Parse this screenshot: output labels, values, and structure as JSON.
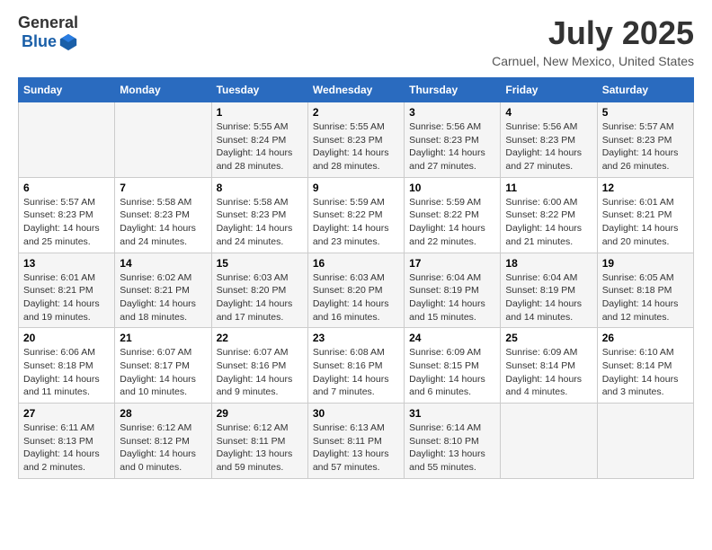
{
  "header": {
    "logo_general": "General",
    "logo_blue": "Blue",
    "title": "July 2025",
    "location": "Carnuel, New Mexico, United States"
  },
  "calendar": {
    "days_of_week": [
      "Sunday",
      "Monday",
      "Tuesday",
      "Wednesday",
      "Thursday",
      "Friday",
      "Saturday"
    ],
    "weeks": [
      [
        {
          "day": "",
          "content": ""
        },
        {
          "day": "",
          "content": ""
        },
        {
          "day": "1",
          "content": "Sunrise: 5:55 AM\nSunset: 8:24 PM\nDaylight: 14 hours and 28 minutes."
        },
        {
          "day": "2",
          "content": "Sunrise: 5:55 AM\nSunset: 8:23 PM\nDaylight: 14 hours and 28 minutes."
        },
        {
          "day": "3",
          "content": "Sunrise: 5:56 AM\nSunset: 8:23 PM\nDaylight: 14 hours and 27 minutes."
        },
        {
          "day": "4",
          "content": "Sunrise: 5:56 AM\nSunset: 8:23 PM\nDaylight: 14 hours and 27 minutes."
        },
        {
          "day": "5",
          "content": "Sunrise: 5:57 AM\nSunset: 8:23 PM\nDaylight: 14 hours and 26 minutes."
        }
      ],
      [
        {
          "day": "6",
          "content": "Sunrise: 5:57 AM\nSunset: 8:23 PM\nDaylight: 14 hours and 25 minutes."
        },
        {
          "day": "7",
          "content": "Sunrise: 5:58 AM\nSunset: 8:23 PM\nDaylight: 14 hours and 24 minutes."
        },
        {
          "day": "8",
          "content": "Sunrise: 5:58 AM\nSunset: 8:23 PM\nDaylight: 14 hours and 24 minutes."
        },
        {
          "day": "9",
          "content": "Sunrise: 5:59 AM\nSunset: 8:22 PM\nDaylight: 14 hours and 23 minutes."
        },
        {
          "day": "10",
          "content": "Sunrise: 5:59 AM\nSunset: 8:22 PM\nDaylight: 14 hours and 22 minutes."
        },
        {
          "day": "11",
          "content": "Sunrise: 6:00 AM\nSunset: 8:22 PM\nDaylight: 14 hours and 21 minutes."
        },
        {
          "day": "12",
          "content": "Sunrise: 6:01 AM\nSunset: 8:21 PM\nDaylight: 14 hours and 20 minutes."
        }
      ],
      [
        {
          "day": "13",
          "content": "Sunrise: 6:01 AM\nSunset: 8:21 PM\nDaylight: 14 hours and 19 minutes."
        },
        {
          "day": "14",
          "content": "Sunrise: 6:02 AM\nSunset: 8:21 PM\nDaylight: 14 hours and 18 minutes."
        },
        {
          "day": "15",
          "content": "Sunrise: 6:03 AM\nSunset: 8:20 PM\nDaylight: 14 hours and 17 minutes."
        },
        {
          "day": "16",
          "content": "Sunrise: 6:03 AM\nSunset: 8:20 PM\nDaylight: 14 hours and 16 minutes."
        },
        {
          "day": "17",
          "content": "Sunrise: 6:04 AM\nSunset: 8:19 PM\nDaylight: 14 hours and 15 minutes."
        },
        {
          "day": "18",
          "content": "Sunrise: 6:04 AM\nSunset: 8:19 PM\nDaylight: 14 hours and 14 minutes."
        },
        {
          "day": "19",
          "content": "Sunrise: 6:05 AM\nSunset: 8:18 PM\nDaylight: 14 hours and 12 minutes."
        }
      ],
      [
        {
          "day": "20",
          "content": "Sunrise: 6:06 AM\nSunset: 8:18 PM\nDaylight: 14 hours and 11 minutes."
        },
        {
          "day": "21",
          "content": "Sunrise: 6:07 AM\nSunset: 8:17 PM\nDaylight: 14 hours and 10 minutes."
        },
        {
          "day": "22",
          "content": "Sunrise: 6:07 AM\nSunset: 8:16 PM\nDaylight: 14 hours and 9 minutes."
        },
        {
          "day": "23",
          "content": "Sunrise: 6:08 AM\nSunset: 8:16 PM\nDaylight: 14 hours and 7 minutes."
        },
        {
          "day": "24",
          "content": "Sunrise: 6:09 AM\nSunset: 8:15 PM\nDaylight: 14 hours and 6 minutes."
        },
        {
          "day": "25",
          "content": "Sunrise: 6:09 AM\nSunset: 8:14 PM\nDaylight: 14 hours and 4 minutes."
        },
        {
          "day": "26",
          "content": "Sunrise: 6:10 AM\nSunset: 8:14 PM\nDaylight: 14 hours and 3 minutes."
        }
      ],
      [
        {
          "day": "27",
          "content": "Sunrise: 6:11 AM\nSunset: 8:13 PM\nDaylight: 14 hours and 2 minutes."
        },
        {
          "day": "28",
          "content": "Sunrise: 6:12 AM\nSunset: 8:12 PM\nDaylight: 14 hours and 0 minutes."
        },
        {
          "day": "29",
          "content": "Sunrise: 6:12 AM\nSunset: 8:11 PM\nDaylight: 13 hours and 59 minutes."
        },
        {
          "day": "30",
          "content": "Sunrise: 6:13 AM\nSunset: 8:11 PM\nDaylight: 13 hours and 57 minutes."
        },
        {
          "day": "31",
          "content": "Sunrise: 6:14 AM\nSunset: 8:10 PM\nDaylight: 13 hours and 55 minutes."
        },
        {
          "day": "",
          "content": ""
        },
        {
          "day": "",
          "content": ""
        }
      ]
    ]
  }
}
